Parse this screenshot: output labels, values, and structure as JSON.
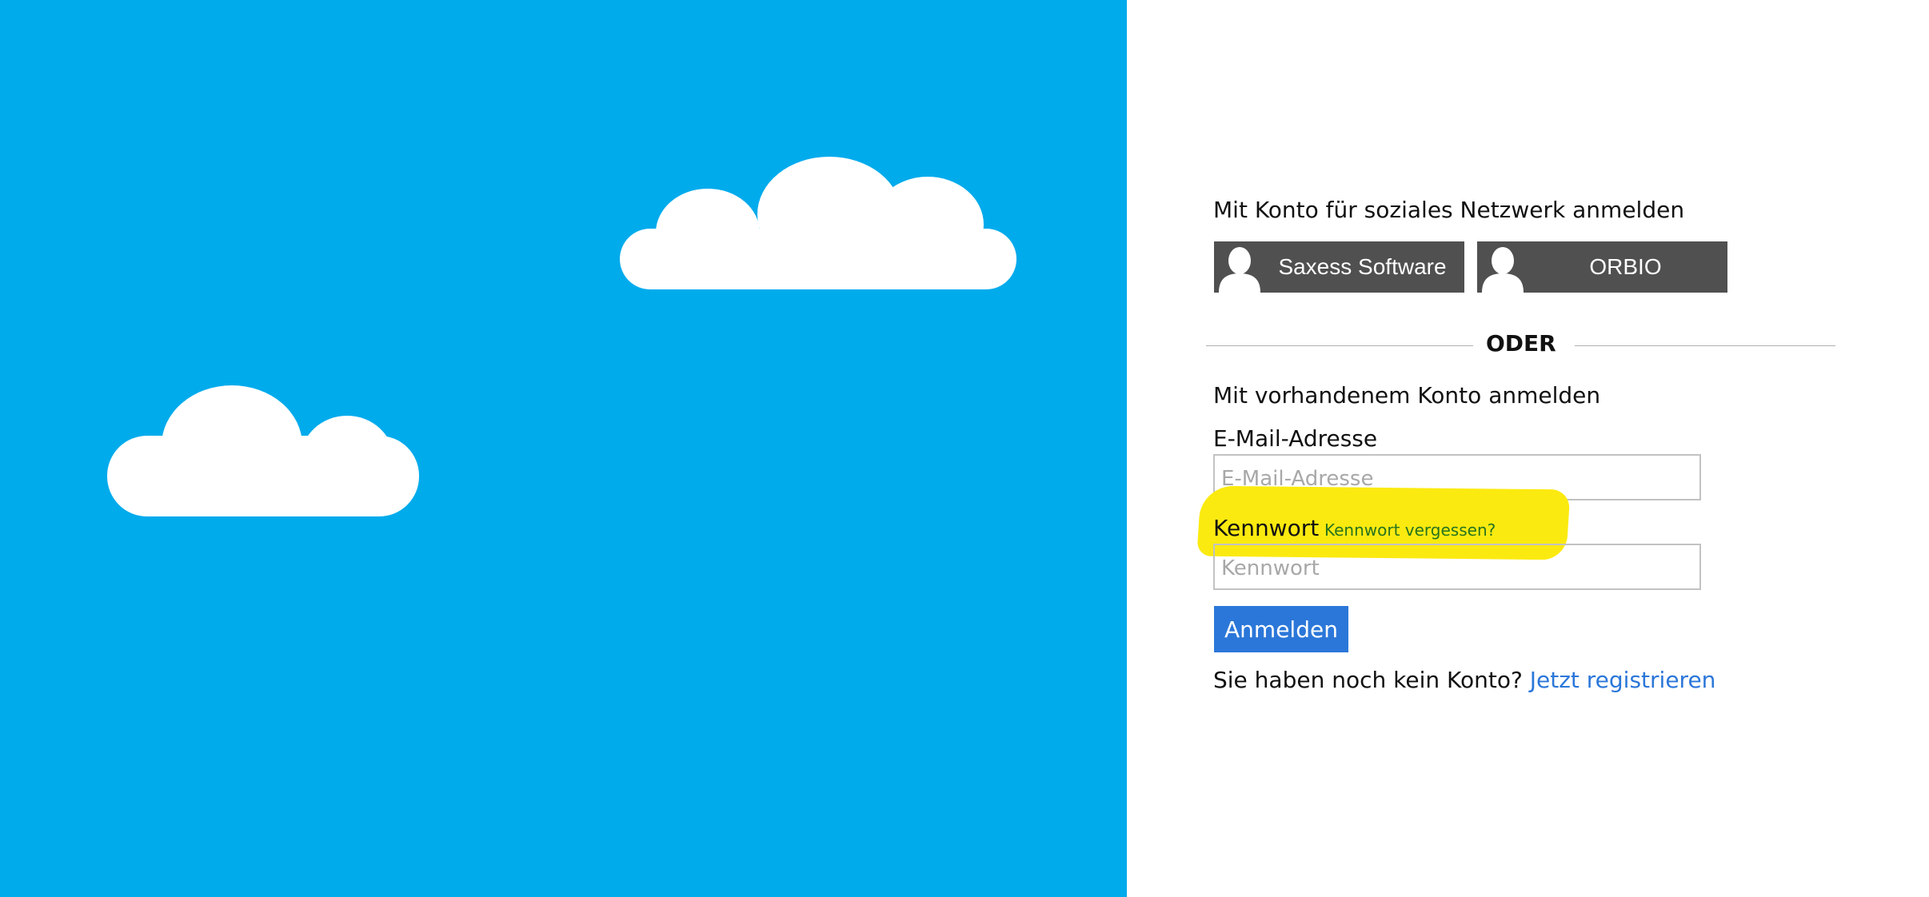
{
  "colors": {
    "sky": "#00abec",
    "cloud": "#ffffff",
    "social_button_bg": "#505050",
    "primary_button": "#2b77d9",
    "link": "#2b77d9",
    "highlight": "#fbea10",
    "forgot_link": "#27731e"
  },
  "left_panel": {
    "clouds": [
      "cloud",
      "cloud"
    ]
  },
  "social": {
    "heading": "Mit Konto für soziales Netzwerk anmelden",
    "buttons": [
      {
        "label": "Saxess Software",
        "icon": "person-icon"
      },
      {
        "label": "ORBIO",
        "icon": "person-icon"
      }
    ]
  },
  "divider": {
    "text": "ODER"
  },
  "local": {
    "heading": "Mit vorhandenem Konto anmelden",
    "email": {
      "label": "E-Mail-Adresse",
      "placeholder": "E-Mail-Adresse",
      "value": ""
    },
    "password": {
      "label": "Kennwort",
      "placeholder": "Kennwort",
      "value": "",
      "forgot_link": "Kennwort vergessen?"
    },
    "submit_label": "Anmelden"
  },
  "register": {
    "prompt": "Sie haben noch kein Konto?",
    "link": "Jetzt registrieren"
  }
}
